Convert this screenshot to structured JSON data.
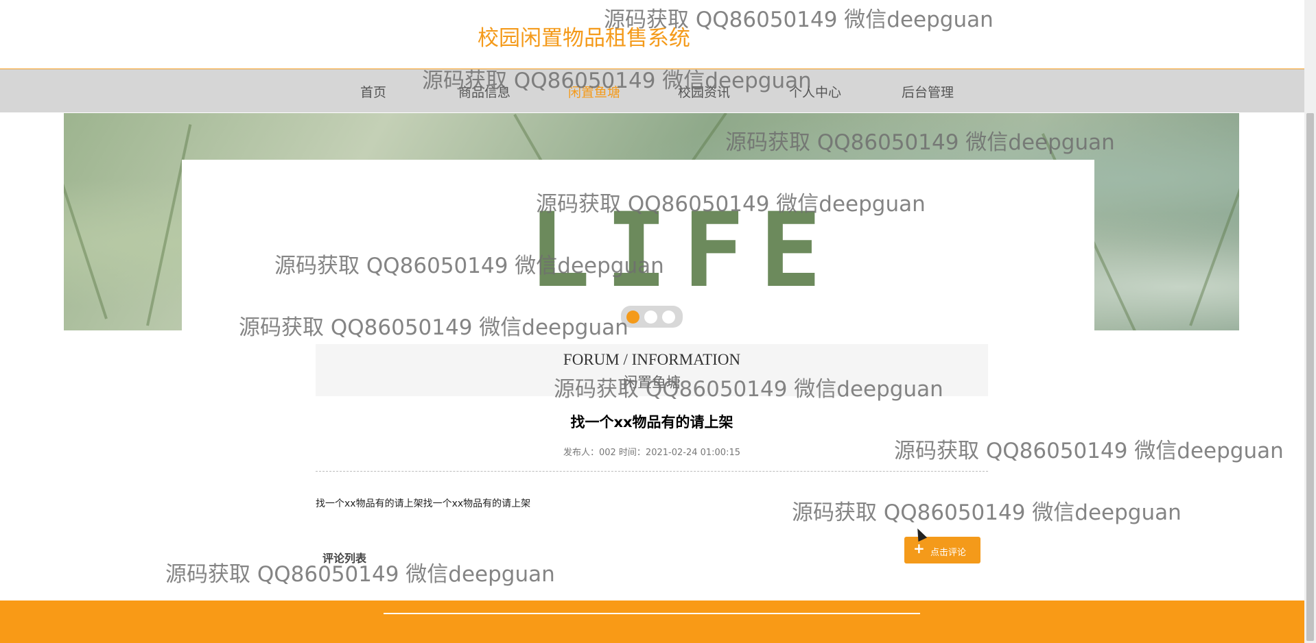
{
  "header": {
    "site_title": "校园闲置物品租售系统"
  },
  "nav": {
    "items": [
      {
        "label": "首页"
      },
      {
        "label": "商品信息"
      },
      {
        "label": "闲置鱼塘"
      },
      {
        "label": "校园资讯"
      },
      {
        "label": "个人中心"
      },
      {
        "label": "后台管理"
      }
    ],
    "active": "闲置鱼塘"
  },
  "banner": {
    "word": "LIFE",
    "slide_count": 3,
    "active_slide": 1
  },
  "section": {
    "title_en": "FORUM / INFORMATION",
    "title_cn": "闲置鱼塘"
  },
  "post": {
    "title": "找一个xx物品有的请上架",
    "meta": "发布人：002 时间：2021-02-24 01:00:15",
    "content": "找一个xx物品有的请上架找一个xx物品有的请上架"
  },
  "comments": {
    "button_label": "点击评论",
    "list_title": "评论列表"
  },
  "watermark": {
    "text": "源码获取 QQ86050149 微信deepguan"
  },
  "colors": {
    "accent": "#f49a1a",
    "nav_bg": "#d6d6d6",
    "footer": "#f99a16"
  }
}
